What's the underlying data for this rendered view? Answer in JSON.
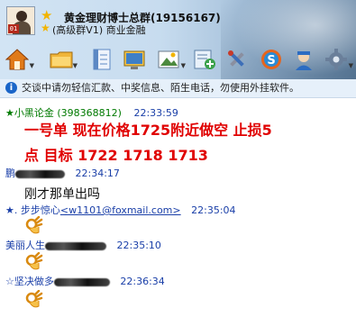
{
  "header": {
    "title": "黄金理财博士总群(19156167)",
    "subtitle": "(高级群V1) 商业金融",
    "avatar_badge": "01"
  },
  "toolbar": {
    "buttons": [
      {
        "name": "home-icon",
        "color": "#e07a1a"
      },
      {
        "name": "folder-icon",
        "color": "#f0b53a"
      },
      {
        "name": "notes-icon",
        "color": "#5c88c4"
      },
      {
        "name": "screen-icon",
        "color": "#3e7fc6"
      },
      {
        "name": "photo-icon",
        "color": "#4d8a3f"
      },
      {
        "name": "add-app-icon",
        "color": "#3aa14a"
      },
      {
        "name": "tools-icon",
        "color": "#8a8fa0"
      },
      {
        "name": "sync-icon",
        "color": "#e5651e"
      },
      {
        "name": "agent-icon",
        "color": "#2c6cc2"
      },
      {
        "name": "settings-icon",
        "color": "#6a7f9a"
      }
    ]
  },
  "notice": {
    "text": "交谈中请勿轻信汇款、中奖信息、陌生电话，勿使用外挂软件。"
  },
  "messages": [
    {
      "sender": "★小黑论金",
      "sender_id": "(398368812)",
      "time": "22:33:59",
      "line1": "一号单  现在价格1725附近做空  止损5",
      "line2": "点  目标  1722  1718  1713"
    },
    {
      "sender": "鹏",
      "time": "22:34:17",
      "text": "刚才那单出吗"
    },
    {
      "sender": "★. 步步惊心",
      "email": "<w1101@foxmail.com>",
      "time": "22:35:04"
    },
    {
      "sender": "美丽人生",
      "time": "22:35:10"
    },
    {
      "sender": "☆坚决做多",
      "time": "22:36:34"
    }
  ]
}
